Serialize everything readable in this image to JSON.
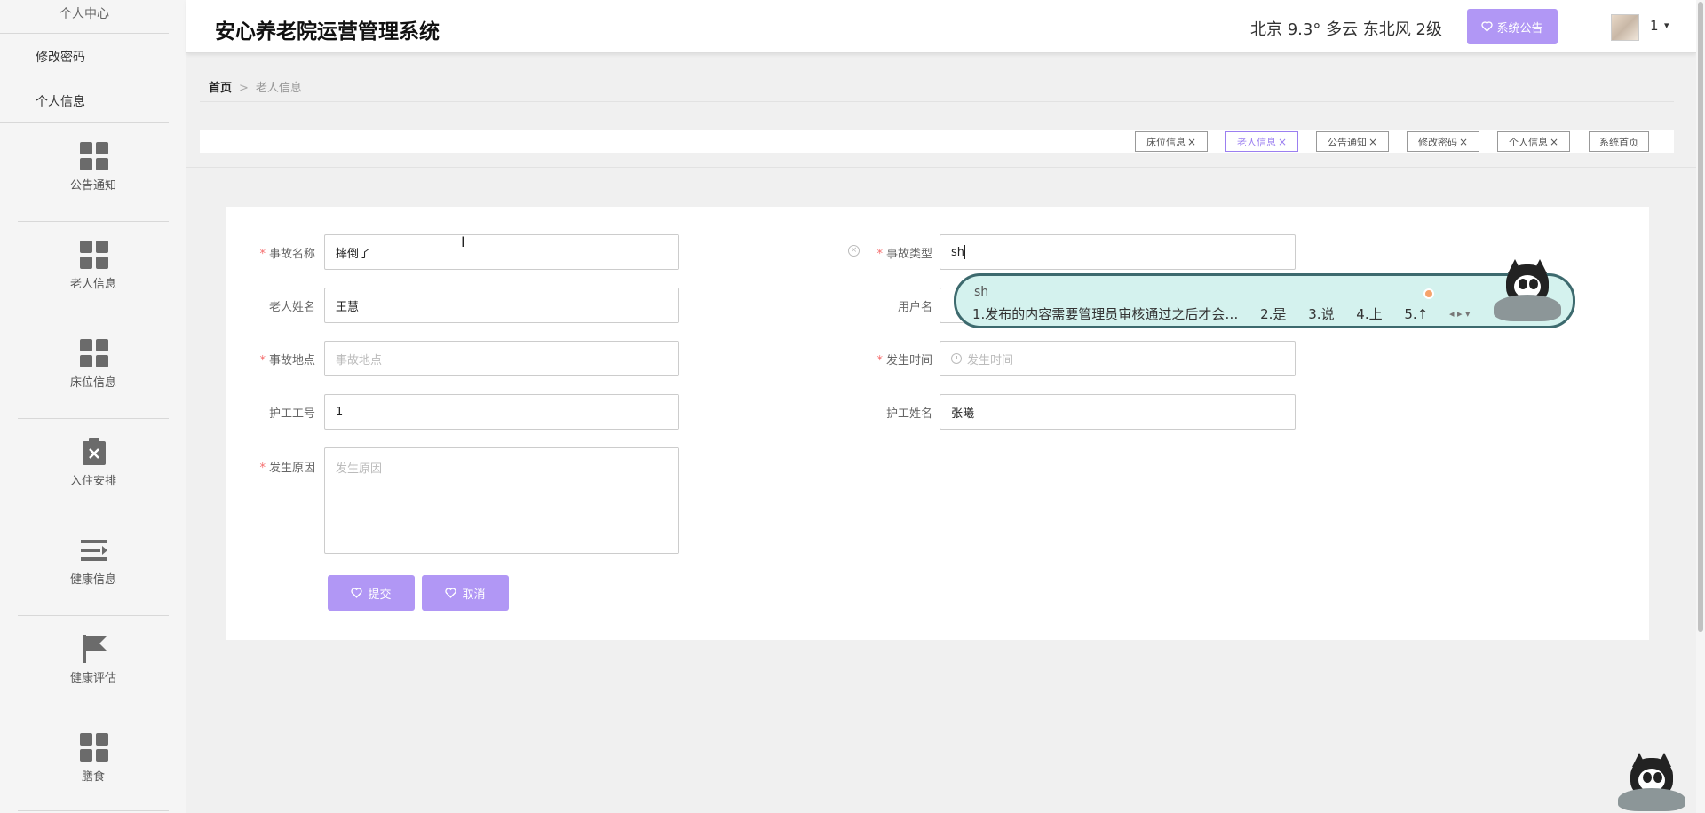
{
  "app": {
    "title": "安心养老院运营管理系统",
    "weather": "北京 9.3° 多云 东北风 2级",
    "notice_button": "系统公告",
    "user": "1",
    "user_caret": "▾"
  },
  "sidebar": {
    "sub_items": [
      {
        "label": "个人中心"
      },
      {
        "label": "修改密码"
      },
      {
        "label": "个人信息"
      }
    ],
    "menu": [
      {
        "label": "公告通知",
        "icon": "grid-icon"
      },
      {
        "label": "老人信息",
        "icon": "grid-icon"
      },
      {
        "label": "床位信息",
        "icon": "grid-icon"
      },
      {
        "label": "入住安排",
        "icon": "clipboard-x-icon"
      },
      {
        "label": "健康信息",
        "icon": "list-arrow-icon"
      },
      {
        "label": "健康评估",
        "icon": "flag-icon"
      },
      {
        "label": "膳食",
        "icon": "grid-icon"
      }
    ]
  },
  "breadcrumb": {
    "home": "首页",
    "separator": ">",
    "current": "老人信息"
  },
  "tabs": [
    {
      "label": "床位信息",
      "close": "×",
      "active": false
    },
    {
      "label": "老人信息",
      "close": "×",
      "active": true
    },
    {
      "label": "公告通知",
      "close": "×",
      "active": false
    },
    {
      "label": "修改密码",
      "close": "×",
      "active": false
    },
    {
      "label": "个人信息",
      "close": "×",
      "active": false
    },
    {
      "label": "系统首页",
      "close": "",
      "active": false
    }
  ],
  "form": {
    "required_mark": "*",
    "accident_name": {
      "label": "事故名称",
      "value": "摔倒了"
    },
    "accident_type": {
      "label": "事故类型",
      "value": "sh"
    },
    "elder_name": {
      "label": "老人姓名",
      "value": "王慧"
    },
    "username": {
      "label": "用户名",
      "value": ""
    },
    "location": {
      "label": "事故地点",
      "placeholder": "事故地点"
    },
    "time": {
      "label": "发生时间",
      "placeholder": "发生时间"
    },
    "nurse_id": {
      "label": "护工工号",
      "value": "1"
    },
    "nurse_name": {
      "label": "护工姓名",
      "value": "张曦"
    },
    "reason": {
      "label": "发生原因",
      "placeholder": "发生原因"
    },
    "submit": "提交",
    "cancel": "取消",
    "clear_glyph": "×"
  },
  "ime": {
    "input": "sh",
    "candidates": [
      "1.发布的内容需要管理员审核通过之后才会…",
      "2.是",
      "3.说",
      "4.上",
      "5.↑"
    ],
    "nav": "◂ ▸ ▾"
  },
  "colors": {
    "accent": "#b197f5",
    "active_tab": "#9b7ff0",
    "required": "#f56c6c"
  }
}
